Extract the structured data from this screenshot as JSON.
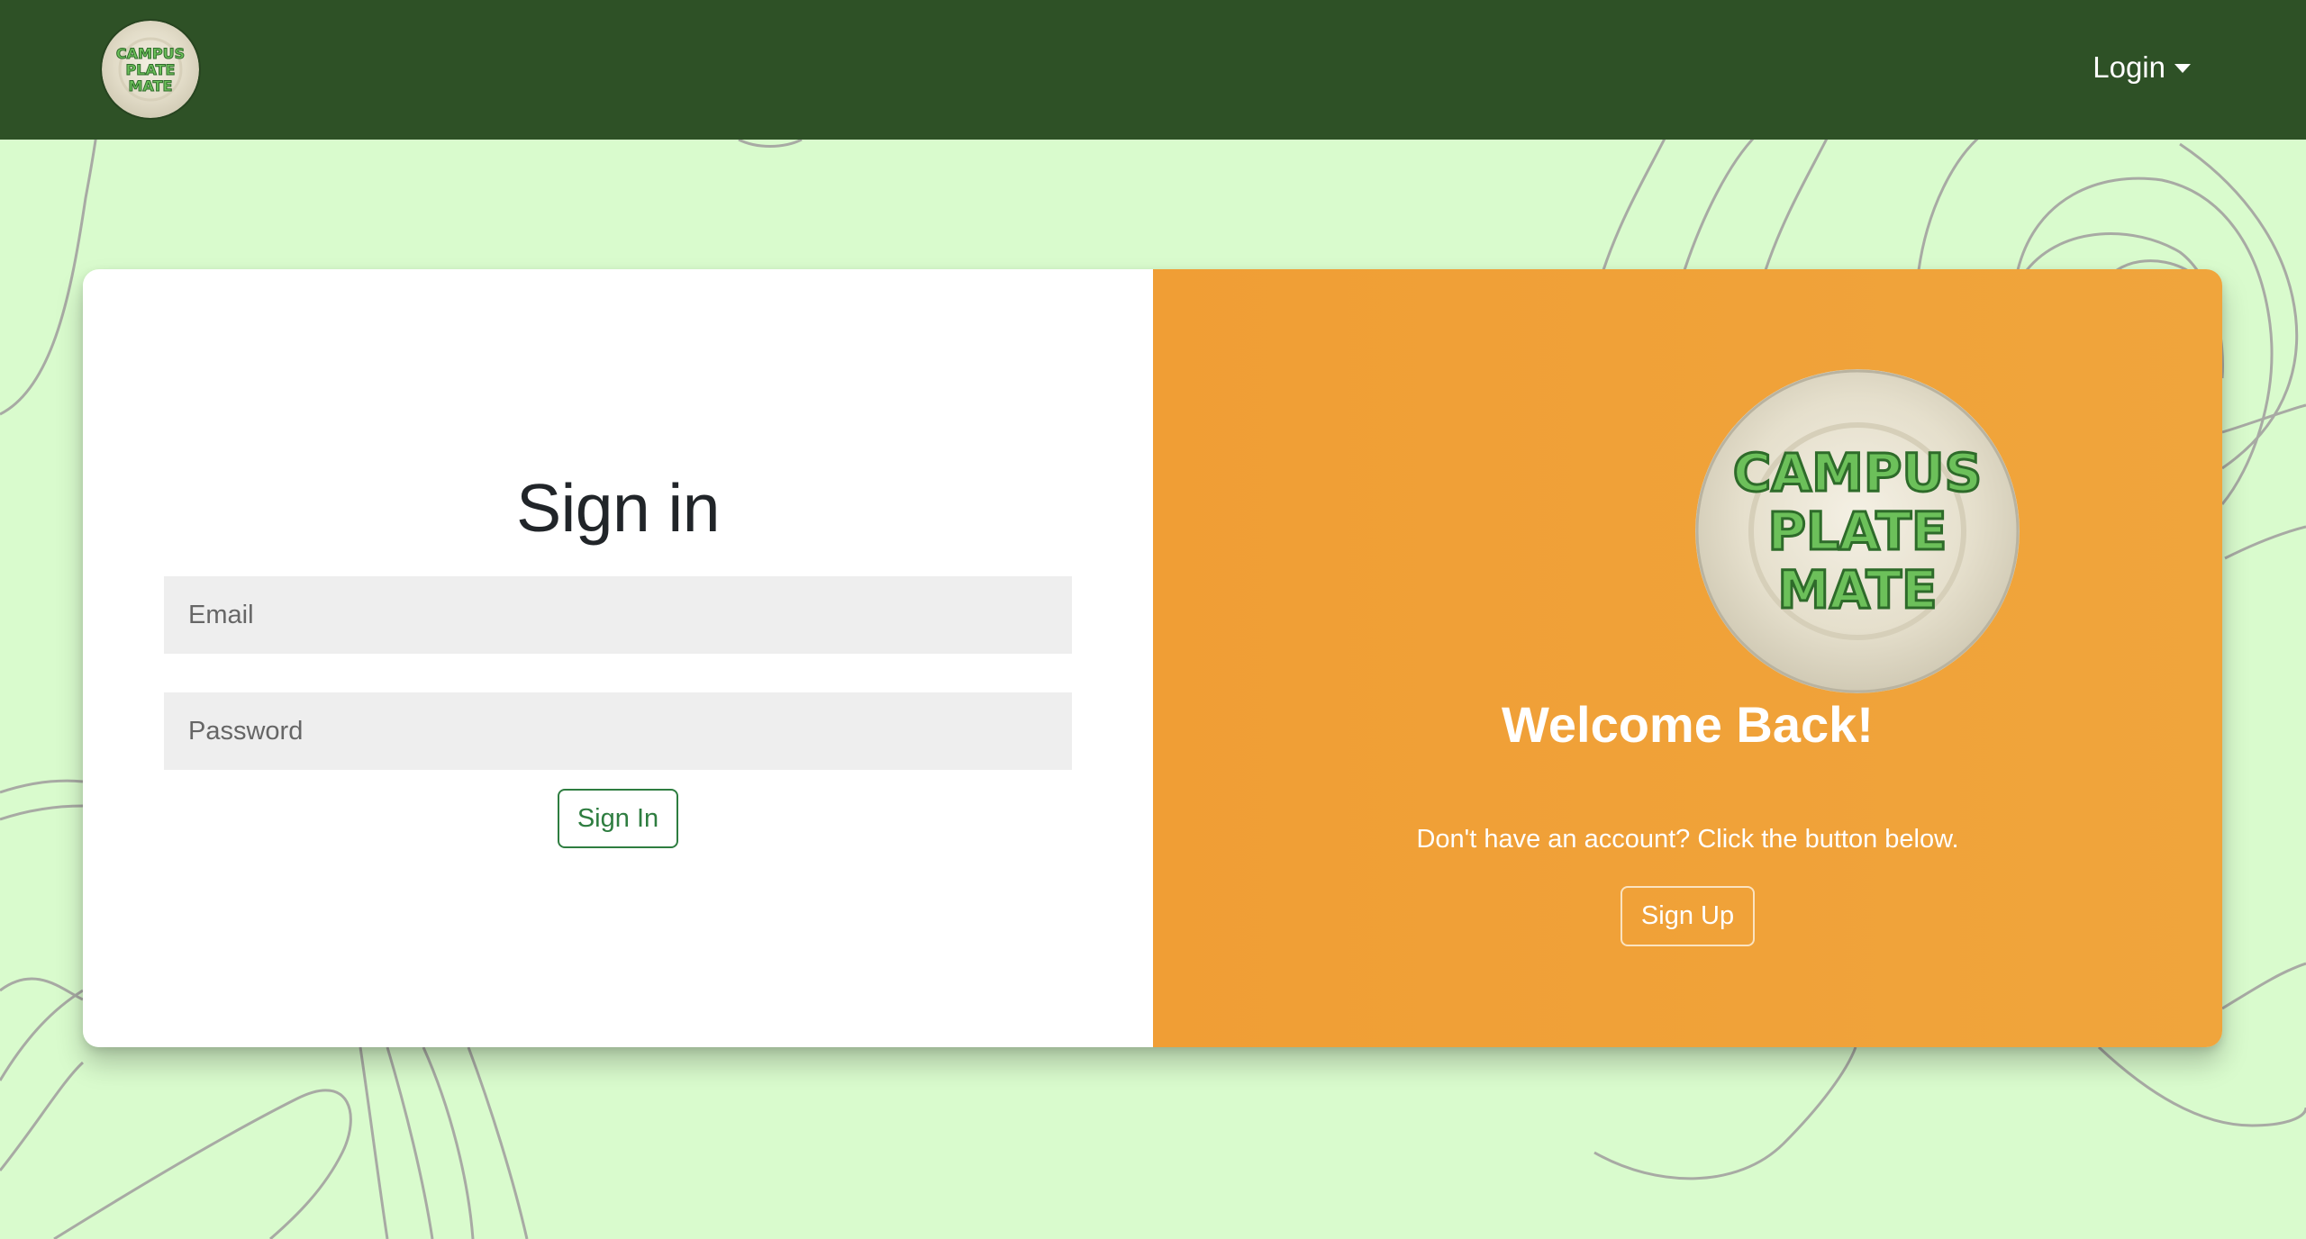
{
  "brand": {
    "logo_lines": [
      "CAMPUS",
      "PLATE",
      "MATE"
    ]
  },
  "nav": {
    "login_label": "Login"
  },
  "signin": {
    "title": "Sign in",
    "email_placeholder": "Email",
    "password_placeholder": "Password",
    "submit_label": "Sign In"
  },
  "welcome": {
    "heading": "Welcome Back!",
    "message": "Don't have an account? Click the button below.",
    "signup_label": "Sign Up"
  },
  "colors": {
    "navbar": "#2e5126",
    "background": "#d9fbcd",
    "accent_orange": "#f0a03a",
    "accent_green": "#2e7d40",
    "logo_text": "#6cc05a"
  }
}
